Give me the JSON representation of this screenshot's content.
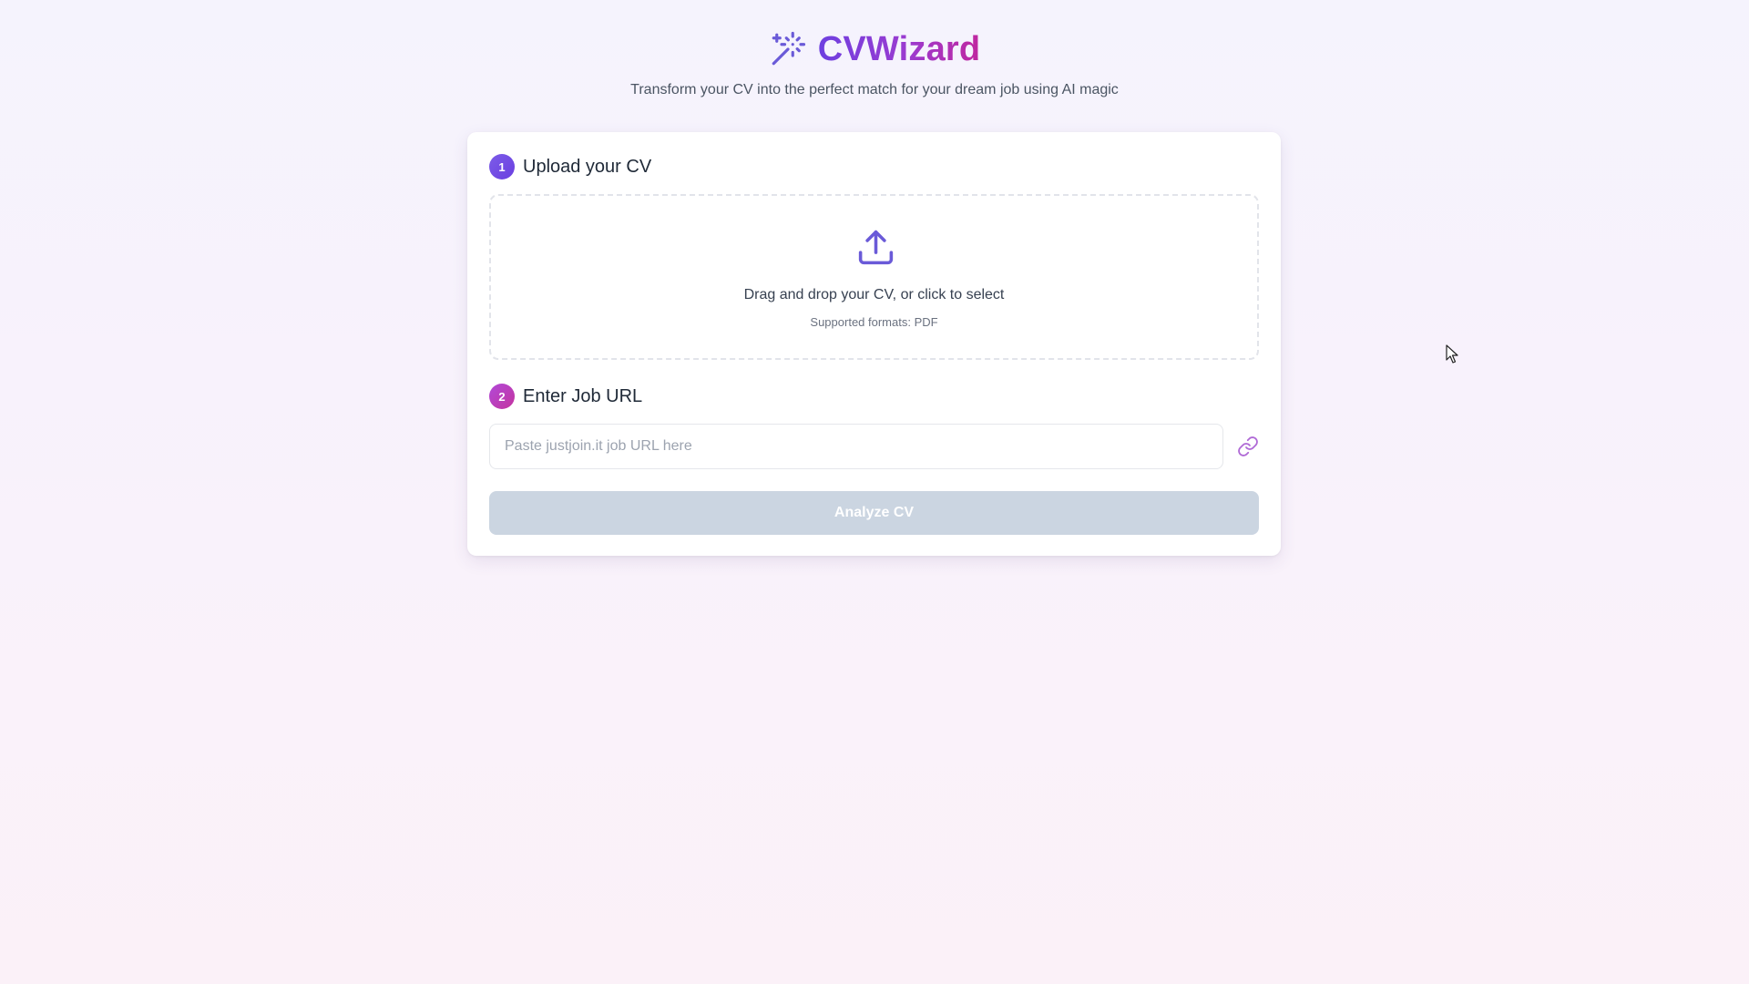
{
  "app": {
    "title": "CVWizard",
    "subtitle": "Transform your CV into the perfect match for your dream job using AI magic",
    "brand_icon": "magic-wand-icon"
  },
  "colors": {
    "brand_gradient_start": "#6d3fe0",
    "brand_gradient_end": "#c0279f",
    "step1_badge": "#7c5ce8",
    "step2_badge": "#c4349f",
    "button_disabled_bg": "#cbd5e1",
    "icon_accent": "#6a5ad8"
  },
  "step_upload": {
    "number": "1",
    "title": "Upload your CV",
    "icon": "upload-icon",
    "prompt": "Drag and drop your CV, or click to select",
    "formats": "Supported formats: PDF"
  },
  "step_url": {
    "number": "2",
    "title": "Enter Job URL",
    "input_value": "",
    "input_placeholder": "Paste justjoin.it job URL here",
    "icon": "link-icon"
  },
  "actions": {
    "analyze_label": "Analyze CV",
    "analyze_disabled": true
  }
}
